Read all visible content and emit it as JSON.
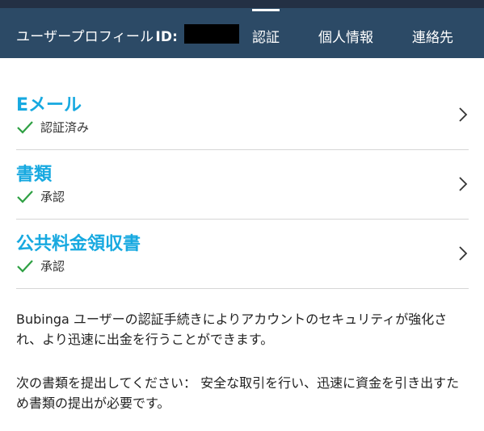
{
  "header": {
    "title": "ユーザープロフィール",
    "id_label": "ID:",
    "tabs": [
      {
        "label": "認証",
        "active": true
      },
      {
        "label": "個人情報",
        "active": false
      },
      {
        "label": "連絡先",
        "active": false
      }
    ]
  },
  "verification_items": [
    {
      "title": "Eメール",
      "status": "認証済み",
      "status_icon": "check-icon"
    },
    {
      "title": "書類",
      "status": "承認",
      "status_icon": "check-icon"
    },
    {
      "title": "公共料金領収書",
      "status": "承認",
      "status_icon": "check-icon"
    }
  ],
  "description": {
    "paragraph1": "Bubinga ユーザーの認証手続きによりアカウントのセキュリティが強化され、より迅速に出金を行うことができます。",
    "paragraph2": "次の書類を提出してください： 安全な取引を行い、迅速に資金を引き出すため書類の提出が必要です。"
  },
  "colors": {
    "header_bg": "#2c4a66",
    "accent": "#17a9e0",
    "check": "#2ea043"
  }
}
